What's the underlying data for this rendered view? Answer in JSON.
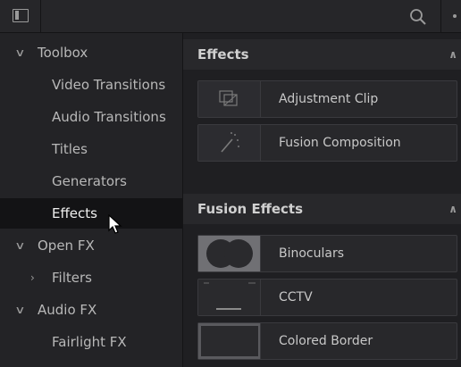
{
  "sidebar": {
    "items": [
      {
        "label": "Toolbox",
        "chevron": "down"
      },
      {
        "label": "Video Transitions"
      },
      {
        "label": "Audio Transitions"
      },
      {
        "label": "Titles"
      },
      {
        "label": "Generators"
      },
      {
        "label": "Effects",
        "selected": true
      },
      {
        "label": "Open FX",
        "chevron": "down"
      },
      {
        "label": "Filters",
        "chevron": "right"
      },
      {
        "label": "Audio FX",
        "chevron": "down"
      },
      {
        "label": "Fairlight FX"
      }
    ]
  },
  "sections": [
    {
      "title": "Effects",
      "items": [
        {
          "label": "Adjustment Clip",
          "icon": "adjustment-clip-icon"
        },
        {
          "label": "Fusion Composition",
          "icon": "magic-wand-icon"
        }
      ]
    },
    {
      "title": "Fusion Effects",
      "items": [
        {
          "label": "Binoculars",
          "icon": "binoculars-thumbnail"
        },
        {
          "label": "CCTV",
          "icon": "cctv-thumbnail"
        },
        {
          "label": "Colored Border",
          "icon": "colored-border-thumbnail"
        }
      ]
    }
  ],
  "colors": {
    "background": "#1e1e21",
    "selected_row": "#131315",
    "section_header": "#28282b"
  }
}
